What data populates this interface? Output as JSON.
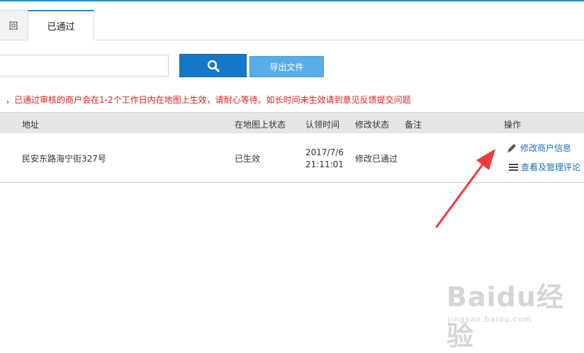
{
  "tabs": [
    {
      "label": "回"
    },
    {
      "label": "已通过"
    }
  ],
  "search": {
    "placeholder": ""
  },
  "toolbar": {
    "export_label": "导出文件"
  },
  "notice": "，已通过审核的商户会在1-2个工作日内在地图上生效，请耐心等待。如长时间未生效请到意见反馈提交问题",
  "table": {
    "columns": [
      "地址",
      "在地图上状态",
      "认领时间",
      "修改状态",
      "备注",
      "操作"
    ],
    "rows": [
      {
        "address": "民安东路海宁街327号",
        "map_status": "已生效",
        "claim_date": "2017/7/6",
        "claim_time": "21:11:01",
        "edit_status": "修改已通过",
        "remark": "",
        "actions": [
          {
            "label": "修改商户信息",
            "icon": "pencil-icon"
          },
          {
            "label": "查看及管理评论",
            "icon": "list-icon"
          }
        ]
      }
    ]
  },
  "watermark": {
    "logo": "Baidu经验",
    "sub": "jingyan.baidu.com"
  },
  "colors": {
    "accent": "#1478c8",
    "export": "#5aaee8",
    "notice": "#e02020",
    "link": "#1a6fb8",
    "arrow": "#f03a3a"
  }
}
